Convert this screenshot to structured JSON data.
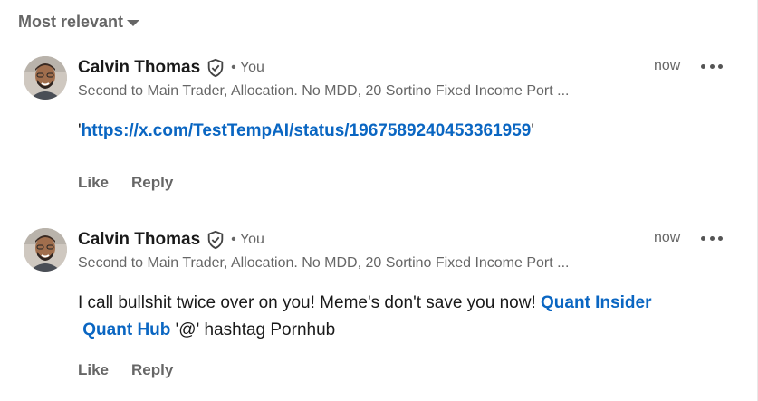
{
  "sort": {
    "label": "Most relevant"
  },
  "comments": [
    {
      "author": "Calvin Thomas",
      "you_label": "• You",
      "headline": "Second to Main Trader, Allocation. No MDD, 20 Sortino Fixed Income Port ...",
      "time": "now",
      "quote_open": "'",
      "link": "https://x.com/TestTempAI/status/1967589240453361959",
      "quote_close": "'",
      "like": "Like",
      "reply": "Reply"
    },
    {
      "author": "Calvin Thomas",
      "you_label": "• You",
      "headline": "Second to Main Trader, Allocation. No MDD, 20 Sortino Fixed Income Port ...",
      "time": "now",
      "text_1": "I call bullshit twice over on you! Meme's don't save you now!",
      "mention_1": "Quant Insider",
      "mention_2": "Quant Hub",
      "text_2": "'@' hashtag Pornhub",
      "like": "Like",
      "reply": "Reply"
    }
  ],
  "colors": {
    "link": "#0a66c2",
    "secondary_text": "#666666",
    "primary_text": "#191919"
  },
  "icons": [
    "verified-shield-icon",
    "more-options-icon",
    "caret-down-icon"
  ]
}
